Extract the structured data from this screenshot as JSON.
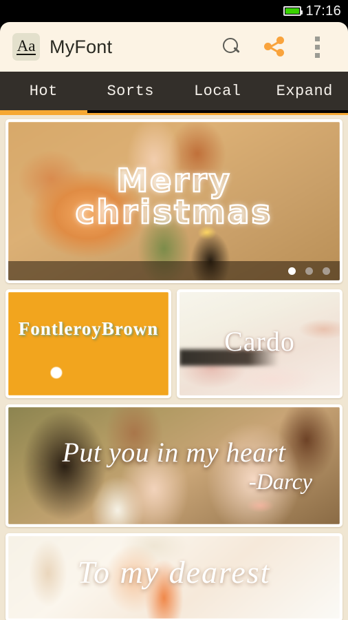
{
  "status_bar": {
    "time": "17:16",
    "battery_icon": "battery-full-icon",
    "battery_color": "#39d300"
  },
  "app_bar": {
    "logo_icon": "aa-logo-icon",
    "logo_text": "Aa",
    "title": "MyFont",
    "actions": [
      {
        "name": "search-icon",
        "label": "Search"
      },
      {
        "name": "share-icon",
        "label": "Share"
      },
      {
        "name": "overflow-menu-icon",
        "label": "More options"
      }
    ],
    "accent_color": "#f6a833",
    "background_color": "#fcf3e4"
  },
  "tabs": {
    "items": [
      {
        "label": "Hot",
        "active": true
      },
      {
        "label": "Sorts",
        "active": false
      },
      {
        "label": "Local",
        "active": false
      },
      {
        "label": "Expand",
        "active": false
      }
    ],
    "indicator_color": "#f6a833",
    "bar_color": "#332f2a"
  },
  "content": {
    "background_color": "#f0e6d2",
    "banner": {
      "name": "featured-banner",
      "line1": "Merry",
      "line2": "christmas",
      "pager": {
        "total": 3,
        "current": 1
      }
    },
    "cards": [
      {
        "name": "font-card-fontleroybrown",
        "label": "FontleroyBrown"
      },
      {
        "name": "font-card-cardo",
        "label": "Cardo"
      },
      {
        "name": "font-card-darcy",
        "label": "Put you in my heart",
        "attribution": "-Darcy"
      },
      {
        "name": "font-card-to-my-dearest",
        "label": "To my dearest"
      }
    ]
  }
}
